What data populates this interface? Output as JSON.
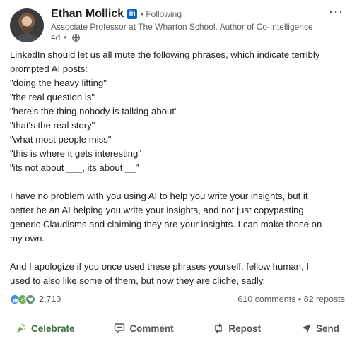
{
  "post": {
    "author": {
      "name": "Ethan Mollick",
      "badge": "in",
      "follow_status": "Following",
      "headline": "Associate Professor at The Wharton School. Author of Co-Intelligence",
      "time": "4d",
      "visibility_icon": "globe-icon"
    },
    "menu_label": "···",
    "body": {
      "lines1": [
        "LinkedIn should let us all mute the following phrases, which indicate terribly",
        "prompted AI posts:",
        "\"doing the heavy lifting\"",
        "\"the real question is\"",
        "\"here's the thing nobody is talking about\"",
        "\"that's the real story\"",
        "\"what most people miss\"",
        "\"this is where it gets interesting\"",
        "\"its not about ___, its about __\""
      ],
      "lines2": [
        "I have no problem with you using AI to help you write your insights, but it",
        "better be an AI helping you write your insights, and not just copypasting",
        "generic Claudisms and claiming they are your insights. I can make those on",
        "my own."
      ],
      "lines3": [
        "And I apologize if you once used these phrases yourself, fellow human, I",
        "used to also like some of them, but now they are cliche, sadly."
      ]
    },
    "stats": {
      "reaction_count": "2,713",
      "comments_reposts": "610 comments • 82 reposts",
      "reaction_icons": [
        "like-icon",
        "celebrate-icon",
        "support-icon"
      ]
    },
    "actions": {
      "celebrate": "Celebrate",
      "comment": "Comment",
      "repost": "Repost",
      "send": "Send"
    },
    "colors": {
      "brand": "#0a66c2",
      "like": "#378fe9",
      "celebrate": "#6dae4f",
      "text": "#1f1f1f",
      "muted": "#5e5e5e"
    }
  }
}
